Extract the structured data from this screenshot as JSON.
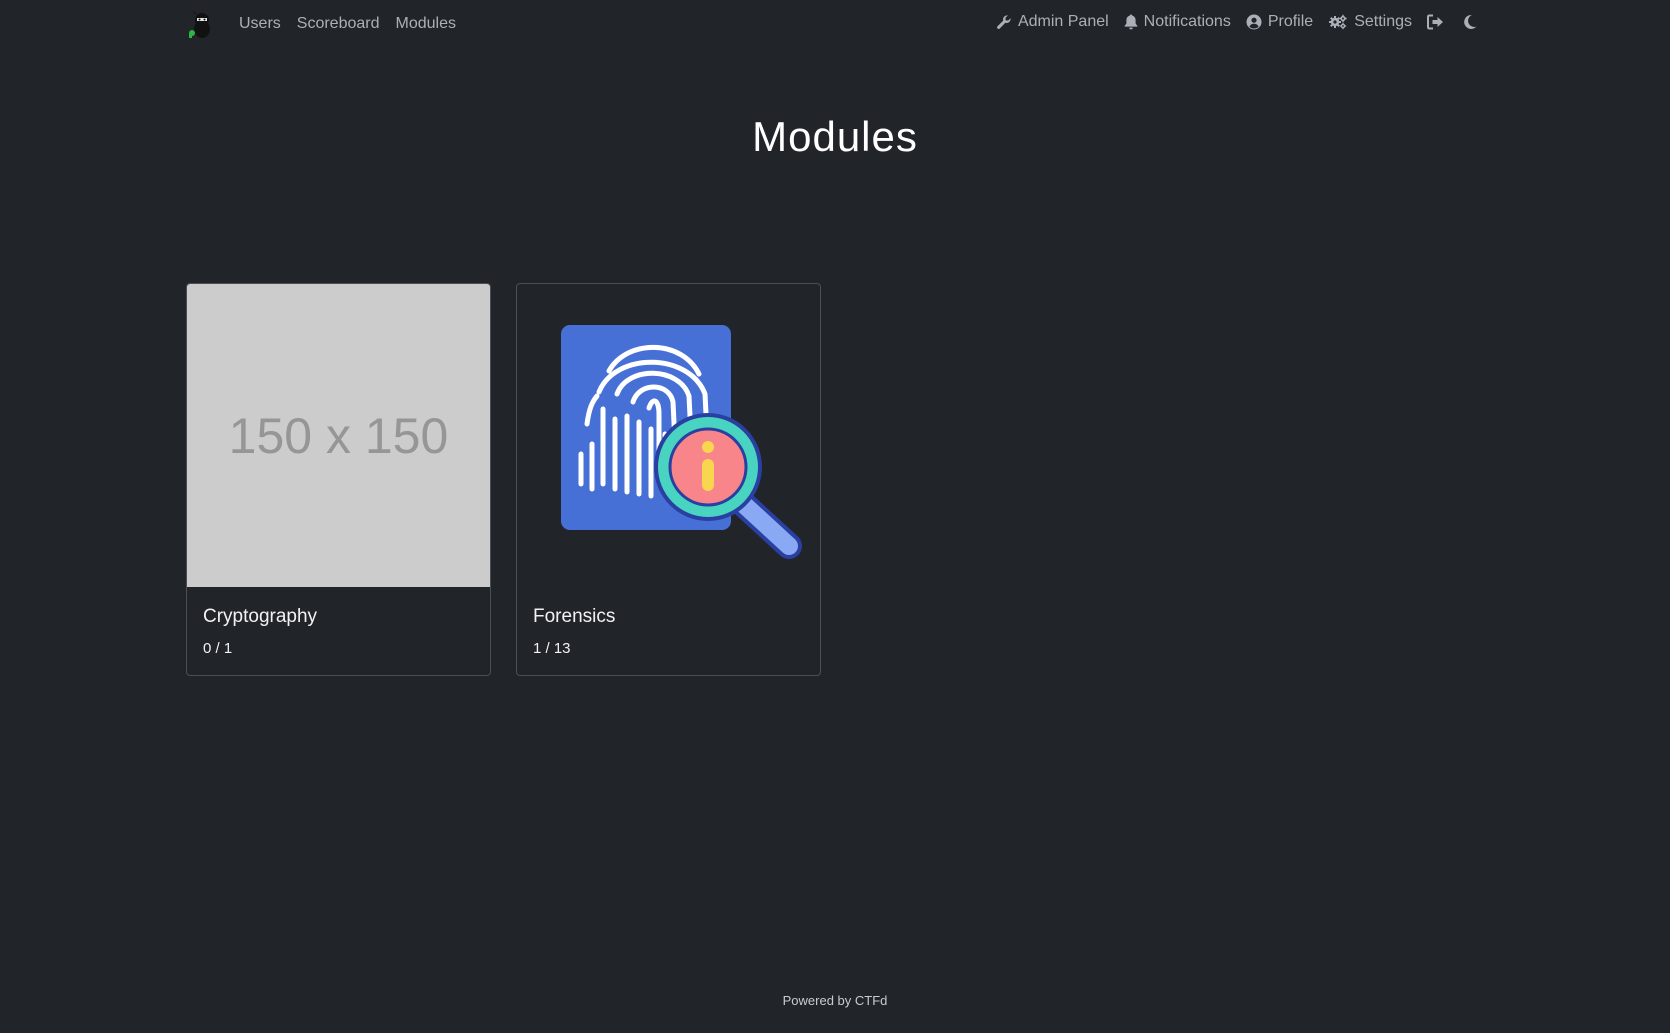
{
  "nav": {
    "left": [
      {
        "label": "Users"
      },
      {
        "label": "Scoreboard"
      },
      {
        "label": "Modules"
      }
    ],
    "right": {
      "admin": "Admin Panel",
      "notifications": "Notifications",
      "profile": "Profile",
      "settings": "Settings"
    },
    "icons": {
      "brand": "ninja-logo",
      "admin": "wrench-icon",
      "notifications": "bell-icon",
      "profile": "user-circle-icon",
      "settings": "cogs-icon",
      "logout": "sign-out-icon",
      "theme": "moon-icon"
    }
  },
  "page": {
    "title": "Modules"
  },
  "cards": [
    {
      "title": "Cryptography",
      "progress": "0 / 1",
      "image_text": "150 x 150"
    },
    {
      "title": "Forensics",
      "progress": "1 / 13"
    }
  ],
  "footer": {
    "text": "Powered by ",
    "link": "CTFd"
  },
  "colors": {
    "background": "#212529",
    "nav_text": "#aab0b6",
    "card_border": "#4a4f55",
    "placeholder_bg": "#cccccc",
    "forensics_doc": "#4670d6",
    "magnifier_ring": "#48d4c0",
    "magnifier_fill": "#f7858a",
    "info_mark": "#f8d64e"
  }
}
